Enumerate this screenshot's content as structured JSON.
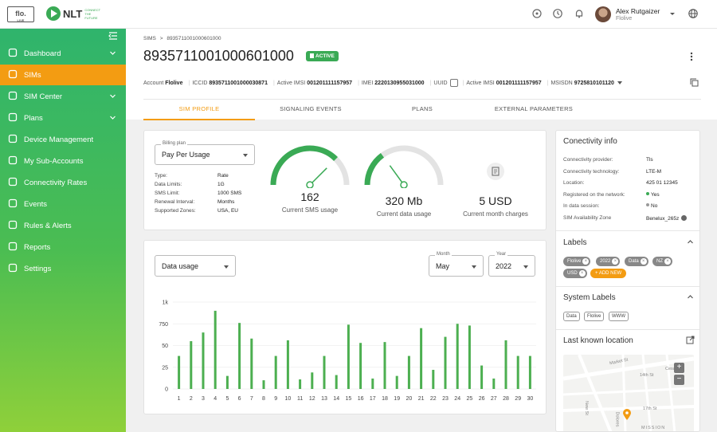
{
  "topbar": {
    "logo_flo": "flo.",
    "logo_flo_sub": "LIVE",
    "logo_nlt": "NLT",
    "logo_nlt_sub": "CONNECT THE FUTURE",
    "user_name": "Alex Rutgaizer",
    "user_org": "Flolive",
    "icons": [
      "support-icon",
      "clock-icon",
      "bell-icon",
      "globe-icon"
    ]
  },
  "sidebar": {
    "items": [
      {
        "label": "Dashboard",
        "icon": "dashboard-icon",
        "chevron": true,
        "active": false
      },
      {
        "label": "SIMs",
        "icon": "sim-icon",
        "chevron": false,
        "active": true
      },
      {
        "label": "SIM Center",
        "icon": "sim-center-icon",
        "chevron": true,
        "active": false
      },
      {
        "label": "Plans",
        "icon": "plans-icon",
        "chevron": true,
        "active": false
      },
      {
        "label": "Device Management",
        "icon": "device-icon",
        "chevron": false,
        "active": false
      },
      {
        "label": "My Sub-Accounts",
        "icon": "users-icon",
        "chevron": false,
        "active": false
      },
      {
        "label": "Connectivity Rates",
        "icon": "rates-icon",
        "chevron": false,
        "active": false
      },
      {
        "label": "Events",
        "icon": "events-icon",
        "chevron": false,
        "active": false
      },
      {
        "label": "Rules & Alerts",
        "icon": "alert-icon",
        "chevron": false,
        "active": false
      },
      {
        "label": "Reports",
        "icon": "reports-icon",
        "chevron": false,
        "active": false
      },
      {
        "label": "Settings",
        "icon": "settings-icon",
        "chevron": false,
        "active": false
      }
    ]
  },
  "header": {
    "breadcrumb_root": "SIMS",
    "breadcrumb_sep": ">",
    "breadcrumb_current": "8935711001000601000",
    "title": "8935711001000601000",
    "status": "ACTIVE",
    "info": {
      "account_label": "Account",
      "account": "Flolive",
      "iccid_label": "ICCID",
      "iccid": "8935711001000030871",
      "imsi_label": "Active IMSI",
      "imsi": "001201111157957",
      "imei_label": "IMEI",
      "imei": "2220130955031000",
      "uuid_label": "UUID",
      "imsi2_label": "Active IMSI",
      "imsi2": "001201111157957",
      "msisdn_label": "MSISDN",
      "msisdn": "9725810101120"
    },
    "tabs": [
      "SIM PROFILE",
      "SIGNALING EVENTS",
      "PLANS",
      "EXTERNAL PARAMETERS"
    ]
  },
  "billing": {
    "label": "Billing plan",
    "value": "Pay Per Usage",
    "details": [
      {
        "key": "Type:",
        "value": "Rate"
      },
      {
        "key": "Data Limits:",
        "value": "1G"
      },
      {
        "key": "SMS Limit:",
        "value": "1000 SMS"
      },
      {
        "key": "Renewal Interval:",
        "value": "Months"
      },
      {
        "key": "Supported Zones:",
        "value": "USA, EU"
      }
    ]
  },
  "gauges": {
    "sms": {
      "value": "162",
      "label": "Current SMS usage",
      "fraction": 0.75
    },
    "data": {
      "value": "320 Mb",
      "label": "Current data usage",
      "fraction": 0.3
    },
    "charges": {
      "value": "5 USD",
      "label": "Current month charges"
    }
  },
  "usage_controls": {
    "metric": "Data usage",
    "month_label": "Month",
    "month": "May",
    "year_label": "Year",
    "year": "2022"
  },
  "chart_data": {
    "type": "bar",
    "categories": [
      "1",
      "2",
      "3",
      "4",
      "5",
      "6",
      "7",
      "8",
      "9",
      "10",
      "11",
      "12",
      "13",
      "14",
      "15",
      "16",
      "17",
      "18",
      "19",
      "20",
      "21",
      "22",
      "23",
      "24",
      "25",
      "26",
      "27",
      "28",
      "29",
      "30"
    ],
    "values": [
      380,
      550,
      650,
      900,
      150,
      760,
      580,
      100,
      380,
      560,
      110,
      190,
      380,
      160,
      740,
      530,
      120,
      540,
      150,
      380,
      700,
      220,
      600,
      750,
      730,
      270,
      120,
      560,
      380,
      380
    ],
    "yticks": [
      "0",
      "25",
      "50",
      "750",
      "1k"
    ],
    "ytick_values": [
      0,
      250,
      500,
      750,
      1000
    ],
    "ylim": [
      0,
      1000
    ],
    "color": "#4caf50"
  },
  "connectivity": {
    "title": "Conectivity info",
    "rows": [
      {
        "key": "Connectivity provider:",
        "value": "Tls"
      },
      {
        "key": "Connectivity technology:",
        "value": "LTE-M"
      },
      {
        "key": "Location:",
        "value": "425 01 12345"
      },
      {
        "key": "Registered on the network:",
        "value": "Yes"
      },
      {
        "key": "In data session:",
        "value": "No"
      },
      {
        "key": "SIM Availability Zone",
        "value": "Benelux_265z"
      }
    ]
  },
  "labels": {
    "title": "Labels",
    "chips": [
      "Flolive",
      "2022",
      "Data",
      "NZ",
      "USD"
    ],
    "add": "+ ADD NEW"
  },
  "system_labels": {
    "title": "System Labels",
    "chips": [
      "Data",
      "Flolive",
      "WWW"
    ]
  },
  "location": {
    "title": "Last known location",
    "streets": [
      "Market St",
      "14th St",
      "Cesar F",
      "17th St",
      "New St",
      "Dolores",
      "MISSION"
    ],
    "zoom_in": "+",
    "zoom_out": "−"
  },
  "colors": {
    "green": "#3aaa55",
    "orange": "#f39c12",
    "sidebar_top": "#2fb46c",
    "sidebar_bottom": "#8fd03a"
  }
}
